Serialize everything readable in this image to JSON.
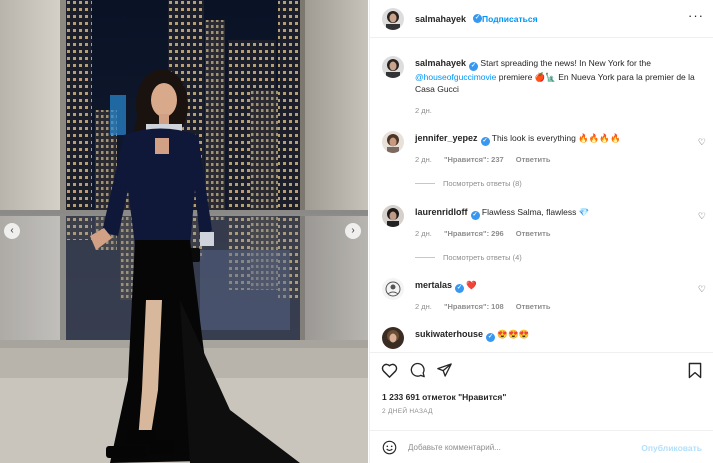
{
  "header": {
    "username": "salmahayek",
    "follow_label": "Подписаться",
    "more_icon": "more-horizontal-icon"
  },
  "caption": {
    "username": "salmahayek",
    "text_before": "Start spreading the news! In New York for the ",
    "mention": "@houseofguccimovie",
    "text_after": " premiere 🍎🗽 En Nueva York para la premier de la Casa Gucci",
    "time": "2 дн."
  },
  "comments": [
    {
      "username": "jennifer_yepez",
      "text": "This look is everything 🔥🔥🔥🔥",
      "time": "2 дн.",
      "likes": "\"Нравится\": 237",
      "reply": "Ответить",
      "view_replies": "Посмотреть ответы (8)"
    },
    {
      "username": "laurenridloff",
      "text": "Flawless Salma, flawless 💎",
      "time": "2 дн.",
      "likes": "\"Нравится\": 296",
      "reply": "Ответить",
      "view_replies": "Посмотреть ответы (4)"
    },
    {
      "username": "mertalas",
      "text": "❤️",
      "time": "2 дн.",
      "likes": "\"Нравится\": 108",
      "reply": "Ответить",
      "view_replies": ""
    },
    {
      "username": "sukiwaterhouse",
      "text": "😍😍😍",
      "time": "",
      "likes": "",
      "reply": "",
      "view_replies": ""
    }
  ],
  "likes_text": "1 233 691 отметок \"Нравится\"",
  "date_text": "2 ДНЕЙ НАЗАД",
  "composer": {
    "placeholder": "Добавьте комментарий...",
    "publish_label": "Опубликовать"
  },
  "colors": {
    "link": "#0095f6",
    "verified": "#3897f0",
    "publish_disabled": "#b2dffc",
    "heart_red": "#ed4956"
  }
}
